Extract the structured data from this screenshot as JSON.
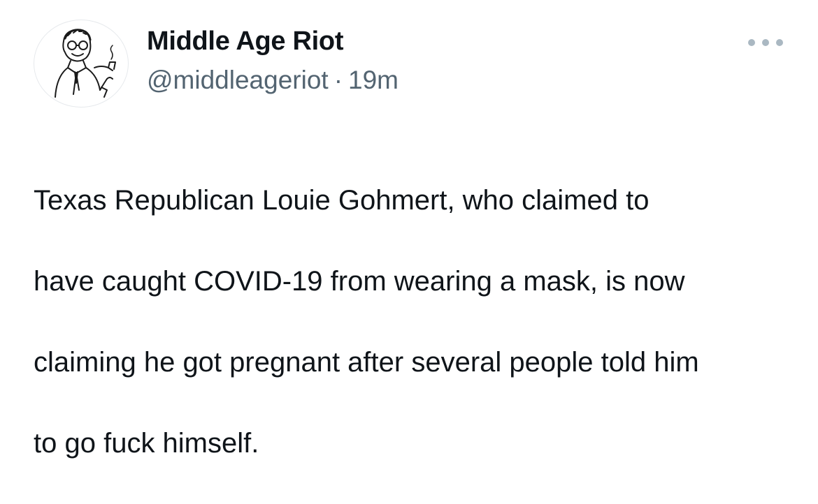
{
  "tweet": {
    "author": {
      "display_name": "Middle Age Riot",
      "handle": "@middleageriot",
      "avatar_icon": "vintage-man-with-pipe-avatar"
    },
    "separator": "·",
    "time_ago": "19m",
    "more_icon": "more-options-icon",
    "text_lines": [
      "Texas Republican Louie Gohmert, who claimed to",
      "have caught COVID-19 from wearing a mask, is now",
      "claiming he got pregnant after several people told him",
      "to go fuck himself."
    ]
  },
  "colors": {
    "primary_text": "#0f1419",
    "secondary_text": "#536471",
    "icon_gray": "#aab8c2"
  }
}
